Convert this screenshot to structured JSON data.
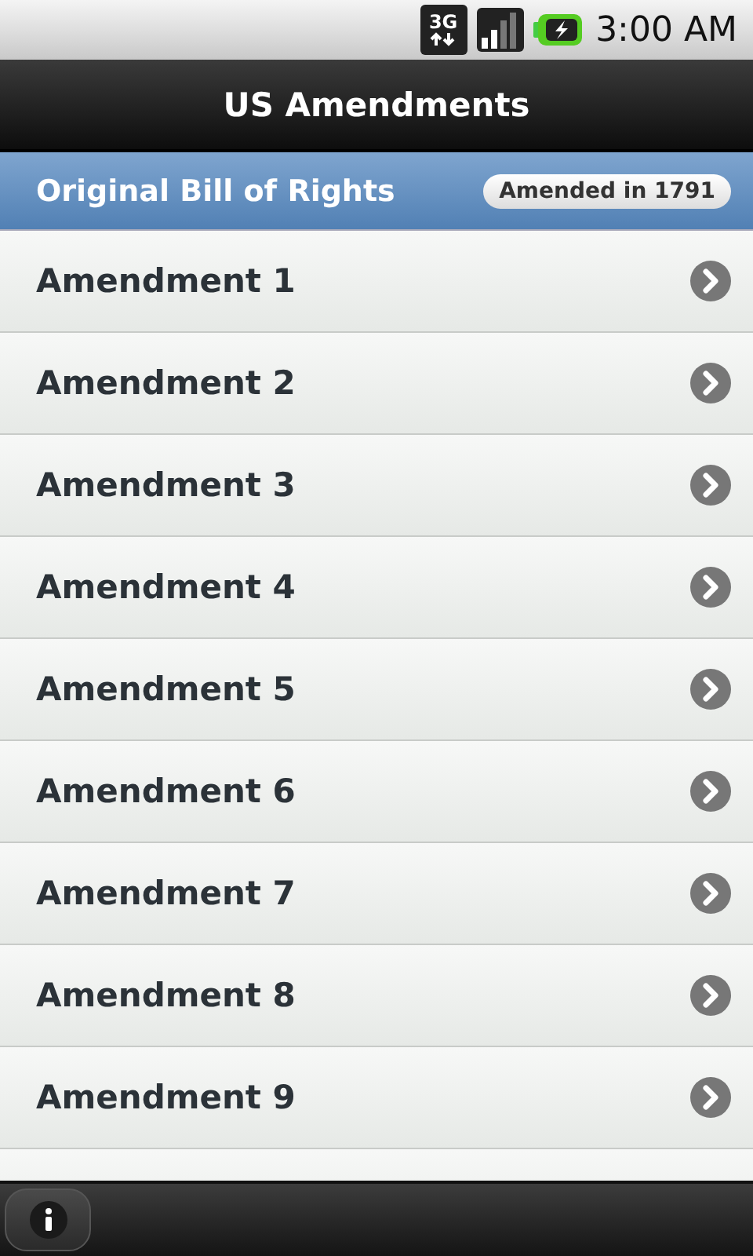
{
  "status_bar": {
    "network": "3G",
    "time": "3:00 AM"
  },
  "title": "US Amendments",
  "section": {
    "title": "Original Bill of Rights",
    "badge": "Amended in 1791"
  },
  "items": [
    {
      "label": "Amendment 1"
    },
    {
      "label": "Amendment 2"
    },
    {
      "label": "Amendment 3"
    },
    {
      "label": "Amendment 4"
    },
    {
      "label": "Amendment 5"
    },
    {
      "label": "Amendment 6"
    },
    {
      "label": "Amendment 7"
    },
    {
      "label": "Amendment 8"
    },
    {
      "label": "Amendment 9"
    }
  ]
}
